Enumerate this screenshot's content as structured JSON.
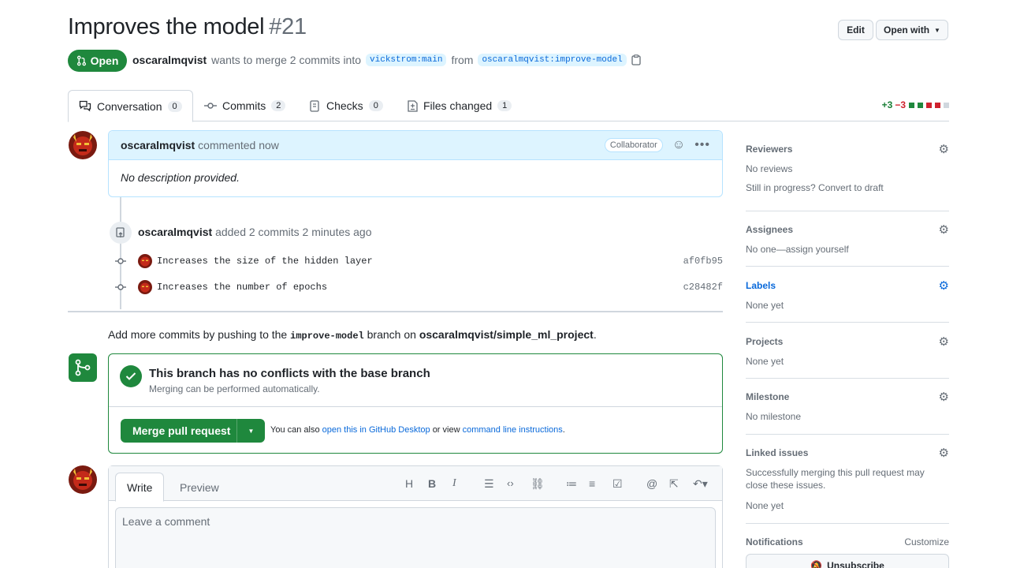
{
  "pr": {
    "title": "Improves the model",
    "number": "#21",
    "state": "Open",
    "author": "oscaralmqvist",
    "merge_text": "wants to merge 2 commits into",
    "base_branch": "vickstrom:main",
    "from_text": "from",
    "head_branch": "oscaralmqvist:improve-model"
  },
  "header_buttons": {
    "edit": "Edit",
    "open_with": "Open with"
  },
  "tabs": [
    {
      "label": "Conversation",
      "count": "0"
    },
    {
      "label": "Commits",
      "count": "2"
    },
    {
      "label": "Checks",
      "count": "0"
    },
    {
      "label": "Files changed",
      "count": "1"
    }
  ],
  "diffstat": {
    "additions": "+3",
    "deletions": "−3"
  },
  "comment": {
    "author": "oscaralmqvist",
    "action": "commented now",
    "role": "Collaborator",
    "body": "No description provided."
  },
  "commits_event": {
    "author": "oscaralmqvist",
    "action": "added 2 commits 2 minutes ago",
    "commits": [
      {
        "message": "Increases the size of the hidden layer",
        "sha": "af0fb95"
      },
      {
        "message": "Increases the number of epochs",
        "sha": "c28482f"
      }
    ]
  },
  "push_hint": {
    "prefix": "Add more commits by pushing to the",
    "branch": "improve-model",
    "middle": "branch on",
    "repo": "oscaralmqvist/simple_ml_project",
    "suffix": "."
  },
  "merge": {
    "title": "This branch has no conflicts with the base branch",
    "subtitle": "Merging can be performed automatically.",
    "button": "Merge pull request",
    "also_text": "You can also",
    "desktop_link": "open this in GitHub Desktop",
    "or_view": "or view",
    "cli_link": "command line instructions",
    "period": "."
  },
  "editor": {
    "write_tab": "Write",
    "preview_tab": "Preview",
    "placeholder": "Leave a comment",
    "toolbar": [
      "H",
      "B",
      "I"
    ]
  },
  "sidebar": {
    "reviewers": {
      "label": "Reviewers",
      "value": "No reviews",
      "extra": "Still in progress? Convert to draft"
    },
    "assignees": {
      "label": "Assignees",
      "value": "No one—assign yourself"
    },
    "labels": {
      "label": "Labels",
      "value": "None yet"
    },
    "projects": {
      "label": "Projects",
      "value": "None yet"
    },
    "milestone": {
      "label": "Milestone",
      "value": "No milestone"
    },
    "linked_issues": {
      "label": "Linked issues",
      "value": "Successfully merging this pull request may close these issues.",
      "extra": "None yet"
    },
    "notifications": {
      "label": "Notifications",
      "customize": "Customize",
      "button": "Unsubscribe"
    }
  },
  "colors": {
    "accent": "#0969da",
    "success": "#1f883d",
    "danger": "#cf222e"
  }
}
